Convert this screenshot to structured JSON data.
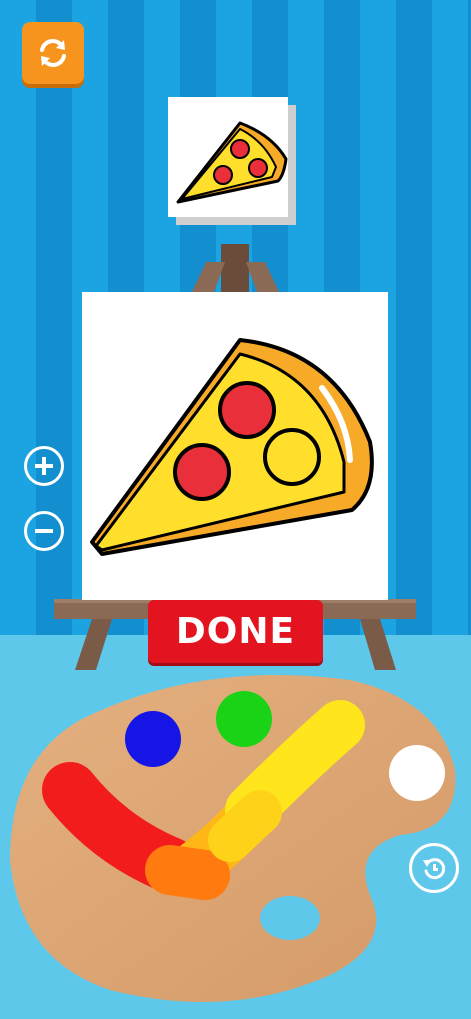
{
  "controls": {
    "refresh_icon": "refresh-icon",
    "zoom_in_icon": "plus-icon",
    "zoom_out_icon": "minus-icon",
    "undo_icon": "undo-icon",
    "done_label": "DONE"
  },
  "reference": {
    "subject": "pizza-slice"
  },
  "palette": {
    "paints": [
      {
        "name": "blue",
        "color": "#1515e6"
      },
      {
        "name": "green",
        "color": "#1ad316"
      },
      {
        "name": "white",
        "color": "#ffffff"
      }
    ],
    "mixed_colors": [
      "#f21c1c",
      "#ff7a0f",
      "#ffe51c"
    ]
  },
  "colors": {
    "wall": "#1ba3e2",
    "accent": "#f7941d",
    "done": "#e3141f",
    "pizza_crust": "#f7a928",
    "pizza_cheese": "#ffdf2b",
    "pepperoni": "#e9303a"
  }
}
